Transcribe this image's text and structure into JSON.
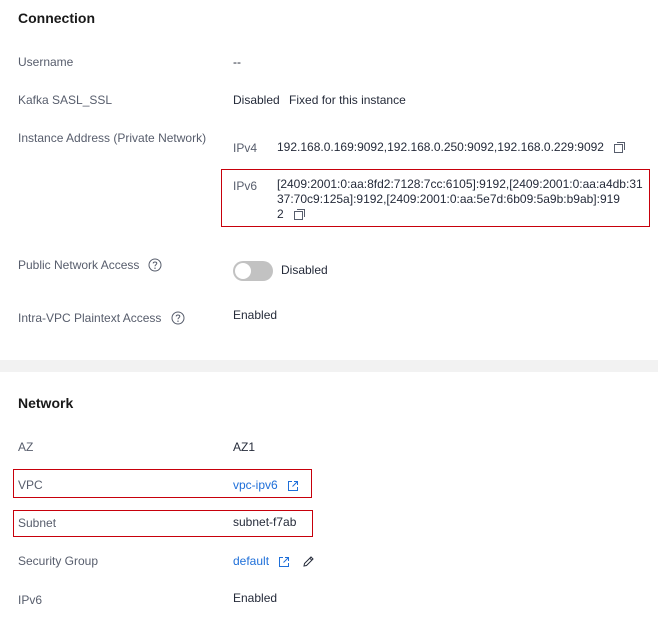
{
  "connection": {
    "title": "Connection",
    "username": {
      "label": "Username",
      "value": "--"
    },
    "sasl": {
      "label": "Kafka SASL_SSL",
      "value": "Disabled",
      "note": "Fixed for this instance"
    },
    "address": {
      "label": "Instance Address (Private Network)",
      "ipv4_tag": "IPv4",
      "ipv4_value": "192.168.0.169:9092,192.168.0.250:9092,192.168.0.229:9092",
      "ipv6_tag": "IPv6",
      "ipv6_line1": "[2409:2001:0:aa:8fd2:7128:7cc:6105]:9192,[2409:2001:0:aa:a4db:31",
      "ipv6_line2": "37:70c9:125a]:9192,[2409:2001:0:aa:5e7d:6b09:5a9b:b9ab]:919",
      "ipv6_line3": "2"
    },
    "public_access": {
      "label": "Public Network Access",
      "value": "Disabled",
      "enabled": false
    },
    "plaintext": {
      "label": "Intra-VPC Plaintext Access",
      "value": "Enabled"
    }
  },
  "network": {
    "title": "Network",
    "az": {
      "label": "AZ",
      "value": "AZ1"
    },
    "vpc": {
      "label": "VPC",
      "value": "vpc-ipv6"
    },
    "subnet": {
      "label": "Subnet",
      "value": "subnet-f7ab"
    },
    "security_group": {
      "label": "Security Group",
      "value": "default"
    },
    "ipv6": {
      "label": "IPv6",
      "value": "Enabled"
    }
  },
  "colors": {
    "link": "#1e6fd9",
    "highlight_border": "#c7000b",
    "toggle_off": "#c2c2c2"
  },
  "icons": {
    "help": "question-circle-icon",
    "copy": "copy-icon",
    "external": "external-link-icon",
    "edit": "pencil-icon"
  }
}
